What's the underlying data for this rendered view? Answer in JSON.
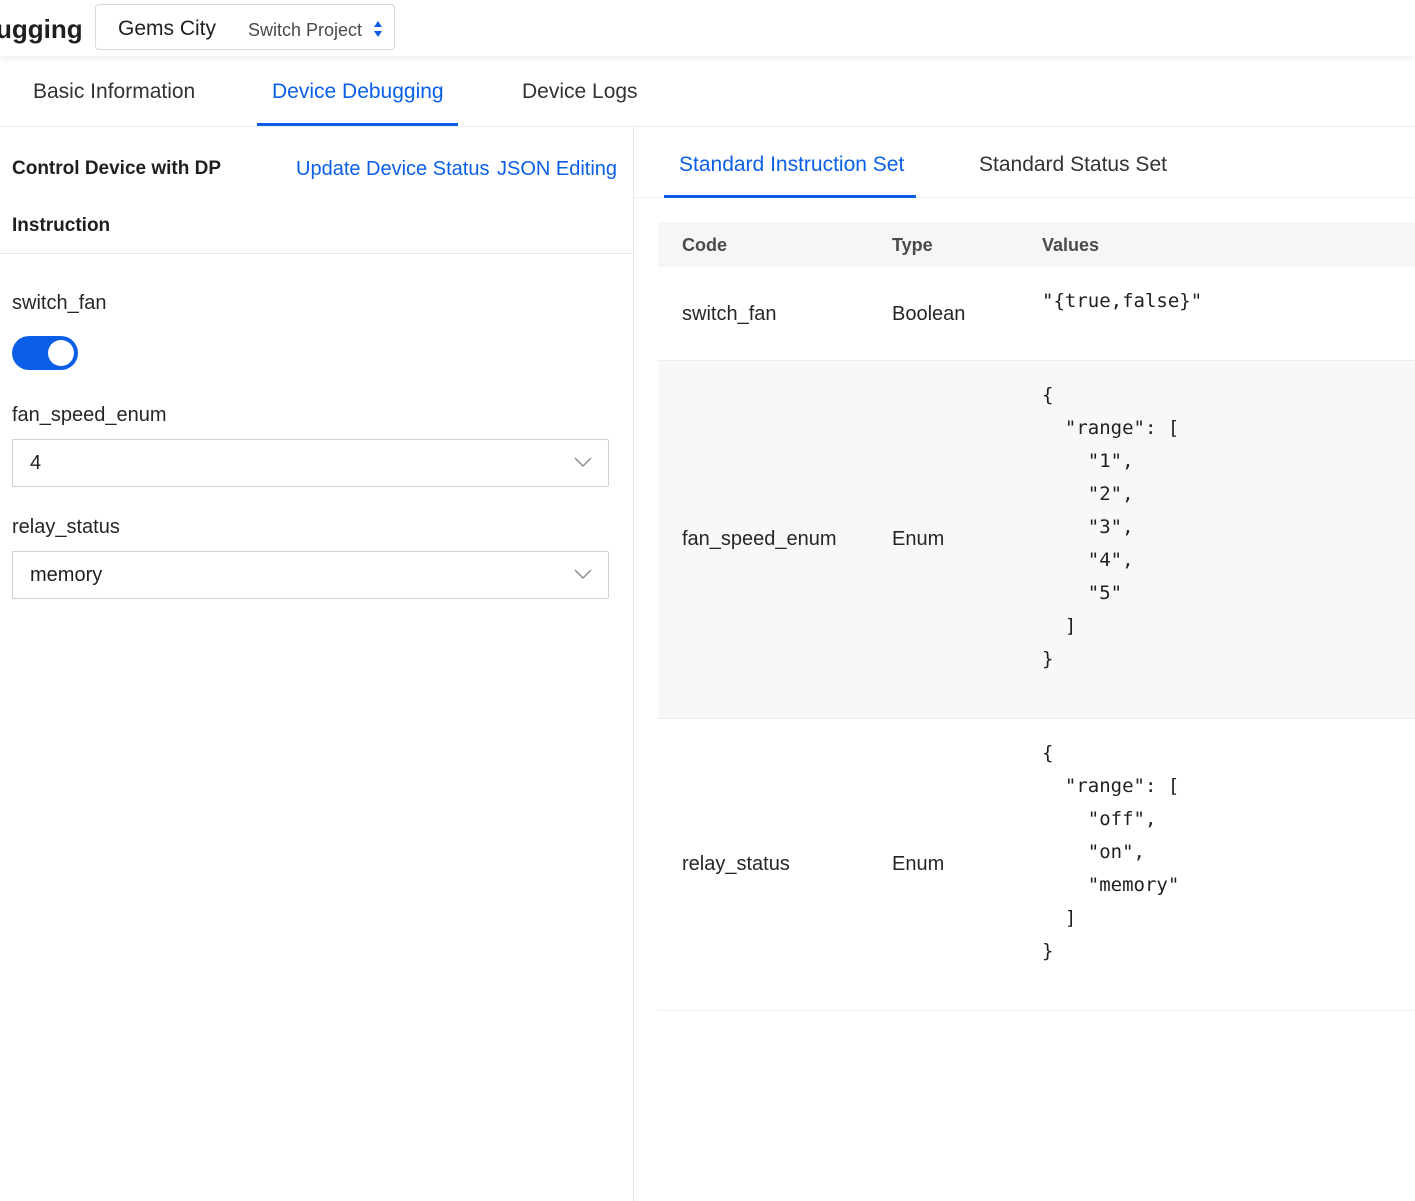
{
  "header": {
    "title": "ugging",
    "project_selector": {
      "city": "Gems City",
      "project": "Switch Project"
    }
  },
  "main_tabs": [
    {
      "label": "Basic Information"
    },
    {
      "label": "Device Debugging"
    },
    {
      "label": "Device Logs"
    }
  ],
  "left": {
    "control_title": "Control Device with DP",
    "links": {
      "update_status": "Update Device Status",
      "json_editing": "JSON Editing"
    },
    "instruction_title": "Instruction",
    "fields": {
      "switch_fan": {
        "label": "switch_fan",
        "on": true
      },
      "fan_speed_enum": {
        "label": "fan_speed_enum",
        "value": "4"
      },
      "relay_status": {
        "label": "relay_status",
        "value": "memory"
      }
    }
  },
  "right": {
    "tabs": [
      {
        "label": "Standard Instruction Set"
      },
      {
        "label": "Standard Status Set"
      }
    ],
    "table": {
      "headers": {
        "code": "Code",
        "type": "Type",
        "values": "Values"
      },
      "rows": [
        {
          "code": "switch_fan",
          "type": "Boolean",
          "values": "\"{true,false}\""
        },
        {
          "code": "fan_speed_enum",
          "type": "Enum",
          "values": "{\n  \"range\": [\n    \"1\",\n    \"2\",\n    \"3\",\n    \"4\",\n    \"5\"\n  ]\n}"
        },
        {
          "code": "relay_status",
          "type": "Enum",
          "values": "{\n  \"range\": [\n    \"off\",\n    \"on\",\n    \"memory\"\n  ]\n}"
        }
      ]
    }
  },
  "colors": {
    "accent": "#0a5fe6",
    "divider": "#eeeeee",
    "row_alt": "#f7f8fa"
  }
}
